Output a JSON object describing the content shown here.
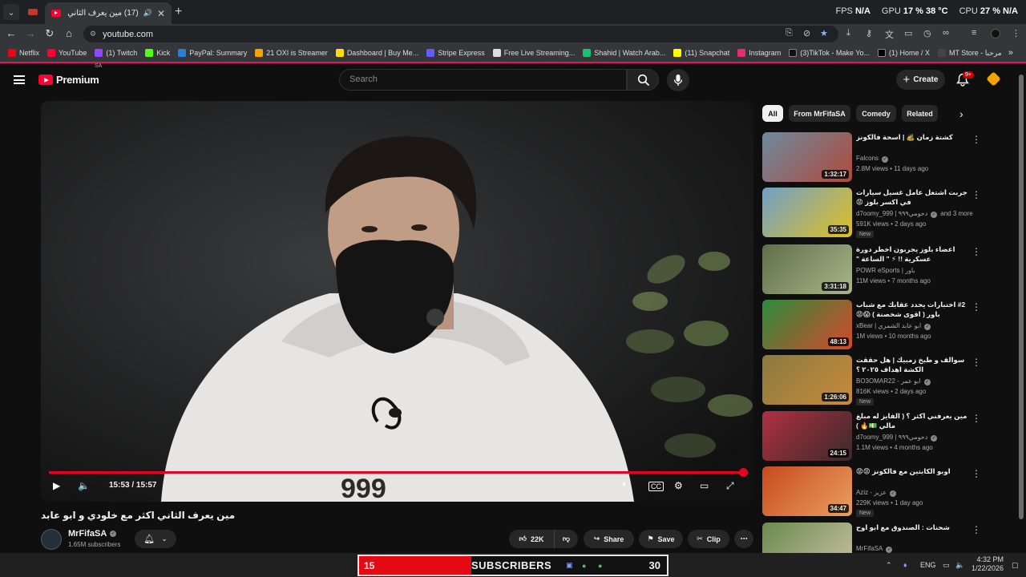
{
  "browser": {
    "tab_title": "(17) مين يعرف الثاني اكثر مع",
    "url": "youtube.com",
    "stats": {
      "fps_label": "FPS",
      "fps_value": "N/A",
      "gpu_label": "GPU",
      "gpu_value": "17 %",
      "gpu_temp": "38 °C",
      "cpu_label": "CPU",
      "cpu_value": "27 %",
      "cpu_temp": "N/A"
    },
    "bookmarks": [
      {
        "label": "Netflix",
        "color": "#e50914"
      },
      {
        "label": "YouTube",
        "color": "#ff0033"
      },
      {
        "label": "(1) Twitch",
        "color": "#9146ff"
      },
      {
        "label": "Kick",
        "color": "#53fc18"
      },
      {
        "label": "PayPal: Summary",
        "color": "#2a7fd4"
      },
      {
        "label": "21 OXI is Streamer",
        "color": "#f5a300"
      },
      {
        "label": "Dashboard | Buy Me...",
        "color": "#ffdd00"
      },
      {
        "label": "Stripe Express",
        "color": "#635bff"
      },
      {
        "label": "Free Live Streaming...",
        "color": "#dddddd"
      },
      {
        "label": "Shahid | Watch Arab...",
        "color": "#1dbf73"
      },
      {
        "label": "(11) Snapchat",
        "color": "#fffc00"
      },
      {
        "label": "Instagram",
        "color": "#e1306c"
      },
      {
        "label": "(3)TikTok - Make Yo...",
        "color": "#111111"
      },
      {
        "label": "(1) Home / X",
        "color": "#000000"
      },
      {
        "label": "MT Store - مرحبا",
        "color": "#444444"
      }
    ]
  },
  "yt": {
    "logo_text": "Premium",
    "logo_region": "SA",
    "search_placeholder": "Search",
    "create_label": "Create",
    "notif_badge": "9+"
  },
  "player": {
    "time": "15:53 / 15:57",
    "progress": 0.996,
    "hoodie_text": "999"
  },
  "video": {
    "title": "مين يعرف الثاني اكثر مع خلودي و ابو عابد",
    "channel": "MrFifaSA",
    "subscribers": "1.65M subscribers",
    "likes": "22K",
    "share_label": "Share",
    "save_label": "Save",
    "clip_label": "Clip"
  },
  "chips": [
    "All",
    "From MrFifaSA",
    "Comedy",
    "Related"
  ],
  "recommendations": [
    {
      "title": "كشتة زمان 🏕️ | اسحة فالكونز",
      "channel": "Falcons",
      "verified": true,
      "meta": "2.8M views • 11 days ago",
      "duration": "1:32:17",
      "new": false,
      "colors": [
        "#6d8aa0",
        "#b04a3a"
      ]
    },
    {
      "title": "جربت اشتغل عامل غسيل سيارات في اكسر بلوز 😡",
      "channel": "d7oomy_999 | دحومي٩٩٩",
      "verified": true,
      "extra": "and 3 more",
      "meta": "591K views • 2 days ago",
      "duration": "35:35",
      "new": true,
      "colors": [
        "#6fa0c8",
        "#e0c020"
      ]
    },
    {
      "title": "اعضاء بلوز يجربون اخطر دورة عسكرية !! ⚡ \" الساعة \"",
      "channel": "POWR eSports | باور",
      "verified": false,
      "meta": "11M views • 7 months ago",
      "duration": "3:31:18",
      "new": false,
      "colors": [
        "#5e7048",
        "#a9b58a"
      ]
    },
    {
      "title": "#2 اختبارات يحدد عقابك مع شباب باور ( اقوى شخصنة ) 😱😡",
      "channel": "xBear | ابو عابد الشمري",
      "verified": true,
      "meta": "1M views • 10 months ago",
      "duration": "48:13",
      "new": false,
      "colors": [
        "#2c8b3c",
        "#d44a2a"
      ]
    },
    {
      "title": "سوالف و طبخ زمبيك | هل حققت الكشة اهداف ٢٠٢٥ ؟",
      "channel": "BO3OMAR22 - ابو عمر",
      "verified": true,
      "meta": "816K views • 2 days ago",
      "duration": "1:26:06",
      "new": true,
      "colors": [
        "#8a7a40",
        "#c88b3a"
      ]
    },
    {
      "title": "مين يعرفني اكثر ؟ ( الفايز له مبلغ مالي 💵🔥 )",
      "channel": "d7oomy_999 | دحومي٩٩٩",
      "verified": true,
      "meta": "1.1M views • 4 months ago",
      "duration": "24:15",
      "new": false,
      "colors": [
        "#b03040",
        "#3a2a2a"
      ]
    },
    {
      "title": "اوبو الكابتين مع فالكونز 😡😡",
      "channel": "Aziz - عزيز",
      "verified": true,
      "meta": "229K views • 1 day ago",
      "duration": "34:47",
      "new": true,
      "colors": [
        "#c84a20",
        "#e8a060"
      ]
    },
    {
      "title": "شحنات : الصندوق مع ابو اوح",
      "channel": "MrFifaSA",
      "verified": true,
      "meta": "648K views • 1 year ago",
      "duration": "",
      "new": false,
      "colors": [
        "#6a8a50",
        "#c8c0a0"
      ]
    }
  ],
  "overlay": {
    "left_count": "15",
    "label": "SUBSCRIBERS",
    "right_count": "30",
    "left_color": "#e50914"
  },
  "taskbar": {
    "lang": "ENG",
    "time": "4:32 PM",
    "date": "1/22/2026"
  }
}
